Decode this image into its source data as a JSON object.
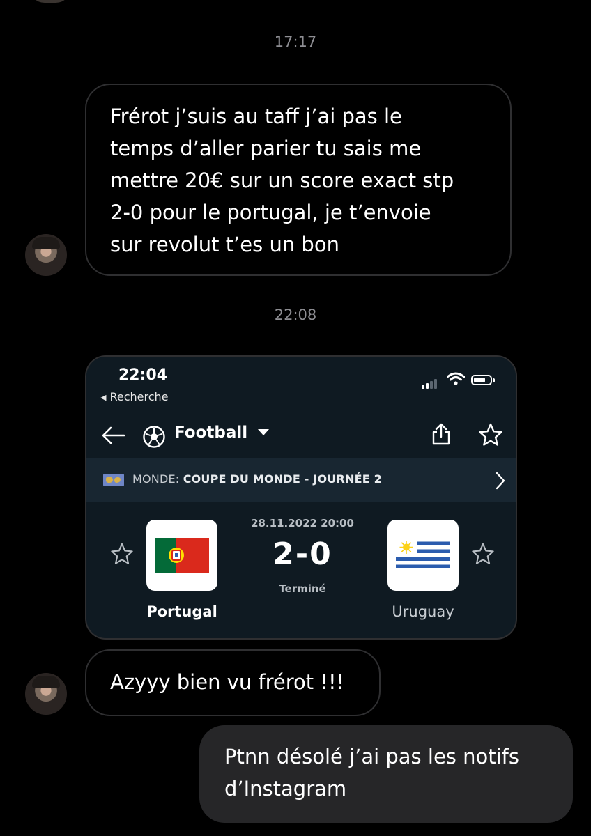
{
  "conversation": {
    "timestamps": [
      "17:17",
      "22:08"
    ],
    "messages": [
      {
        "direction": "incoming",
        "lines": [
          "Frérot j’suis au taff j’ai pas le",
          "temps d’aller parier tu sais me",
          "mettre 20€ sur un score exact stp",
          "2-0 pour le portugal, je t’envoie",
          "sur revolut t’es un bon"
        ]
      },
      {
        "direction": "incoming",
        "lines": [
          "Azyyy bien vu frérot !!!"
        ]
      },
      {
        "direction": "outgoing",
        "lines": [
          "Ptnn désolé j’ai pas les notifs",
          "d’Instagram"
        ]
      }
    ]
  },
  "screenshot": {
    "status_time": "22:04",
    "back_label": "Recherche",
    "sport": "Football",
    "league_prefix": "MONDE:",
    "league_name": "COUPE DU MONDE - JOURNÉE 2",
    "match": {
      "date": "28.11.2022 20:00",
      "score": "2-0",
      "status": "Terminé",
      "home": "Portugal",
      "away": "Uruguay"
    }
  },
  "icons": {
    "nav_back": "arrow-left-icon",
    "sport": "soccer-ball-icon",
    "share": "share-icon",
    "favorite": "star-outline-icon"
  },
  "colors": {
    "background": "#000000",
    "incoming_border": "#2f2f31",
    "outgoing_bubble": "#262628",
    "screenshot_bg": "#0f1a22",
    "league_bar": "#182631",
    "portugal_green": "#046a38",
    "portugal_red": "#da291c",
    "uruguay_blue": "#2b5cae"
  }
}
